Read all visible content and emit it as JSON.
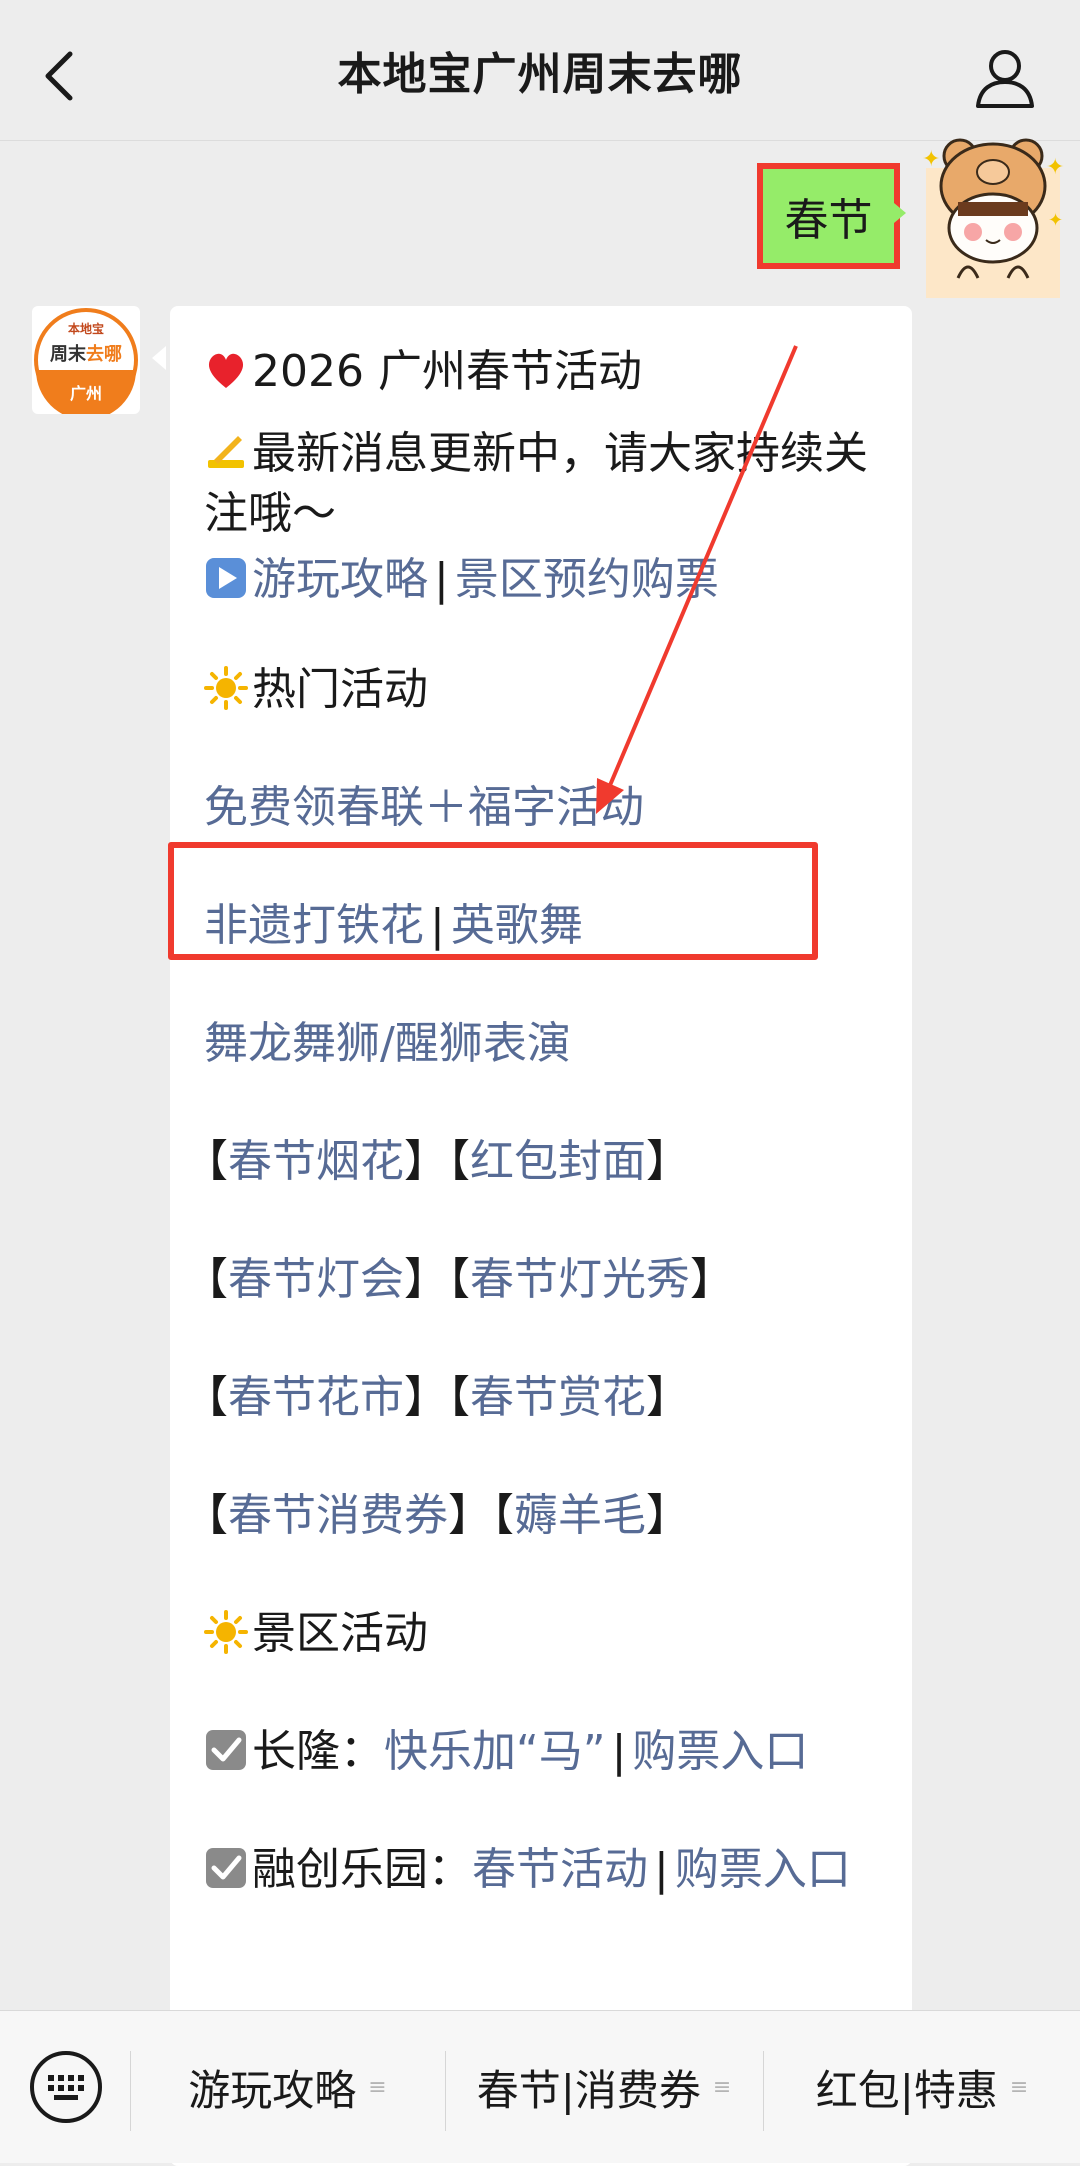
{
  "header": {
    "title": "本地宝广州周末去哪",
    "back_icon": "chevron-left-icon",
    "profile_icon": "person-icon"
  },
  "user_message": {
    "text": "春节"
  },
  "bot": {
    "avatar": {
      "line1": "本地宝",
      "line2a": "周末",
      "line2b": "去哪",
      "line3": "广州"
    },
    "lines": {
      "title": "2026 广州春节活动",
      "notice": "最新消息更新中，请大家持续关注哦～",
      "guide_link": "游玩攻略",
      "ticket_link": "景区预约购票",
      "hot_heading": "热门活动",
      "free_couplets": "免费领春联＋福字活动",
      "iron_flower": "非遗打铁花",
      "yingge": "英歌舞",
      "lion_dance": "舞龙舞狮/醒狮表演",
      "fireworks": "春节烟花",
      "red_envelope": "红包封面",
      "lantern": "春节灯会",
      "light_show": "春节灯光秀",
      "flower_market": "春节花市",
      "flower_viewing": "春节赏花",
      "vouchers": "春节消费券",
      "freebies": "薅羊毛",
      "scenic_heading": "景区活动",
      "chimelong_label": "长隆：",
      "chimelong_link": "快乐加“马”",
      "chimelong_ticket": "购票入口",
      "sunac_label": "融创乐园：",
      "sunac_link": "春节活动",
      "sunac_ticket": "购票入口"
    },
    "separator": "|",
    "bracket_open": "【",
    "bracket_close": "】"
  },
  "bottom_menu": {
    "keyboard_icon": "keyboard-icon",
    "items": [
      "游玩攻略",
      "春节|消费券",
      "红包|特惠"
    ],
    "menu_marker": "≡"
  },
  "colors": {
    "link": "#576b95",
    "highlight": "#f03a2e",
    "user_bubble": "#95ec69"
  }
}
